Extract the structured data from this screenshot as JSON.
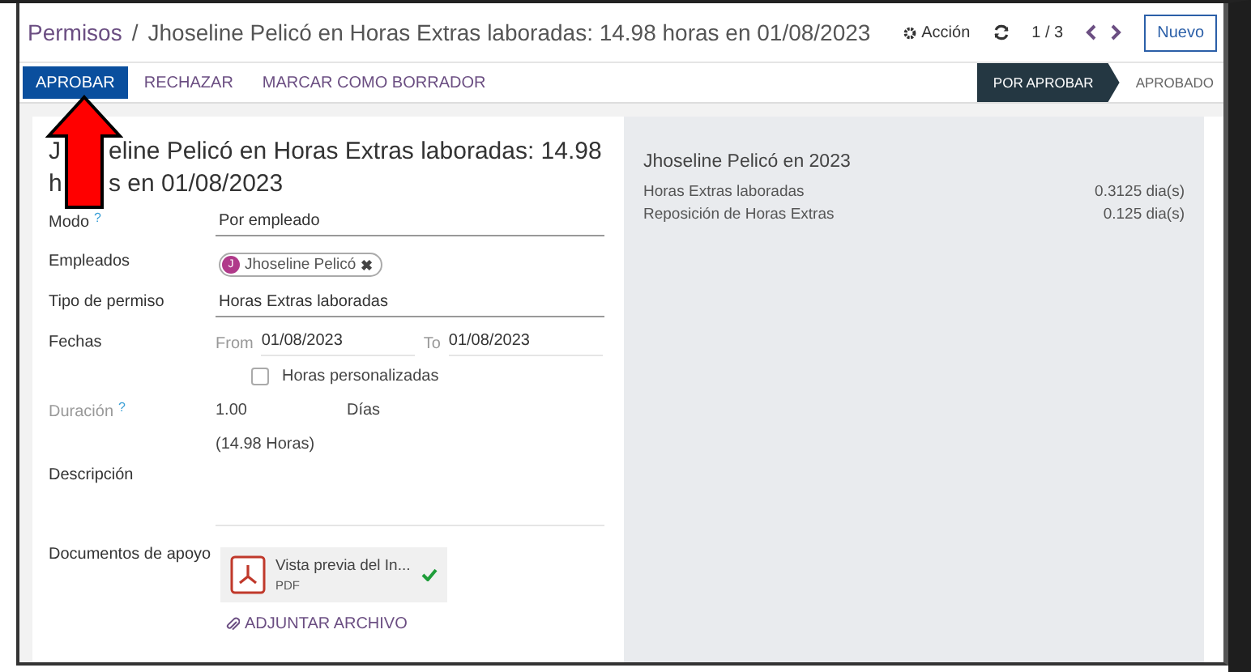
{
  "breadcrumb": {
    "parent": "Permisos",
    "separator": "/",
    "current": "Jhoseline Pelicó en Horas Extras laboradas: 14.98 horas en 01/08/2023"
  },
  "controls": {
    "action": "Acción",
    "pager": "1 / 3",
    "new": "Nuevo"
  },
  "buttons": [
    {
      "label": "APROBAR",
      "primary": true
    },
    {
      "label": "RECHAZAR",
      "primary": false
    },
    {
      "label": "MARCAR COMO BORRADOR",
      "primary": false
    }
  ],
  "stages": [
    {
      "label": "POR APROBAR",
      "selected": true
    },
    {
      "label": "APROBADO",
      "selected": false
    }
  ],
  "form": {
    "title_lines": [
      [
        "J",
        "eline Pelicó en Horas Extras laboradas: 14.98"
      ],
      [
        "h",
        "s en 01/08/2023"
      ]
    ],
    "fields": [
      {
        "kind": "text",
        "label": "Modo",
        "help": "?",
        "value": "Por empleado"
      },
      {
        "kind": "tags",
        "label": "Empleados",
        "tags": [
          {
            "initial": "J",
            "name": "Jhoseline Pelicó",
            "color": "#b03a8a",
            "remove": "✖"
          }
        ]
      },
      {
        "kind": "text",
        "label": "Tipo de permiso",
        "value": "Horas Extras laboradas"
      },
      {
        "kind": "dates",
        "label": "Fechas",
        "from_label": "From",
        "from": "01/08/2023",
        "to_label": "To",
        "to": "01/08/2023"
      },
      {
        "kind": "checkbox",
        "text": "Horas personalizadas",
        "checked": false
      },
      {
        "kind": "duration",
        "label": "Duración",
        "help": "?",
        "readonly": true,
        "value": "1.00",
        "unit": "Días",
        "hours": "(14.98 Horas)"
      },
      {
        "kind": "description",
        "label": "Descripción"
      },
      {
        "kind": "attachments",
        "label": "Documentos de apoyo",
        "files": [
          {
            "name": "Vista previa del In...",
            "type": "PDF",
            "verified": true
          }
        ],
        "add": "ADJUNTAR ARCHIVO"
      }
    ]
  },
  "summary": {
    "title": "Jhoseline Pelicó en 2023",
    "rows": [
      {
        "label": "Horas Extras laboradas",
        "value": "0.3125 dia(s)"
      },
      {
        "label": "Reposición de Horas Extras",
        "value": "0.125 dia(s)"
      }
    ]
  }
}
